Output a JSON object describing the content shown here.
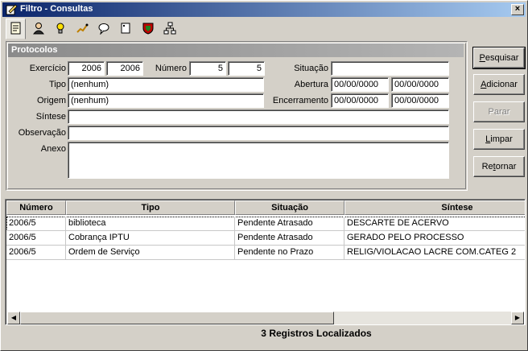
{
  "window": {
    "title": "Filtro - Consultas",
    "close_label": "×"
  },
  "toolbar": {
    "tools": [
      {
        "icon": "document-icon"
      },
      {
        "icon": "person-icon"
      },
      {
        "icon": "bulb-person-icon"
      },
      {
        "icon": "pencil-route-icon"
      },
      {
        "icon": "speech-bubble-icon"
      },
      {
        "icon": "blank-page-icon"
      },
      {
        "icon": "shield-icon"
      },
      {
        "icon": "network-icon"
      }
    ]
  },
  "panel": {
    "title": "Protocolos"
  },
  "form": {
    "exercicio_label": "Exercício",
    "exercicio_from": "2006",
    "exercicio_to": "2006",
    "numero_label": "Número",
    "numero_from": "5",
    "numero_to": "5",
    "situacao_label": "Situação",
    "situacao_value": "",
    "tipo_label": "Tipo",
    "tipo_value": "(nenhum)",
    "abertura_label": "Abertura",
    "abertura_from": "00/00/0000",
    "abertura_to": "00/00/0000",
    "origem_label": "Origem",
    "origem_value": "(nenhum)",
    "encerramento_label": "Encerramento",
    "encerramento_from": "00/00/0000",
    "encerramento_to": "00/00/0000",
    "sintese_label": "Síntese",
    "sintese_value": "",
    "observacao_label": "Observação",
    "observacao_value": "",
    "anexo_label": "Anexo",
    "anexo_value": ""
  },
  "buttons": {
    "pesquisar": "Pesquisar",
    "adicionar": "Adicionar",
    "parar": "Parar",
    "limpar": "Limpar",
    "retornar": "Retornar"
  },
  "table": {
    "columns": [
      "Número",
      "Tipo",
      "Situação",
      "Síntese"
    ],
    "rows": [
      [
        "2006/5",
        "biblioteca",
        "Pendente Atrasado",
        "DESCARTE DE ACERVO"
      ],
      [
        "2006/5",
        "Cobrança IPTU",
        "Pendente Atrasado",
        "GERADO PELO PROCESSO"
      ],
      [
        "2006/5",
        "Ordem de Serviço",
        "Pendente no Prazo",
        "RELIG/VIOLACAO LACRE COM.CATEG 2"
      ]
    ]
  },
  "status": {
    "count": "3",
    "text": "Registros Localizados"
  },
  "colors": {
    "titlebar": "#0a246a",
    "face": "#d4d0c8",
    "panel_header": "#8a8a8a"
  }
}
